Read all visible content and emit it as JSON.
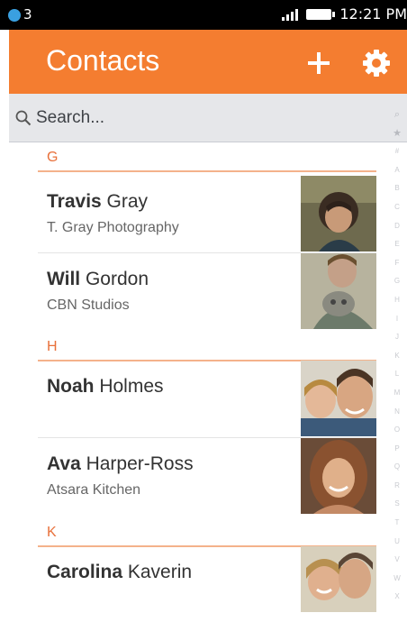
{
  "status_bar": {
    "notification_count": "3",
    "time": "12:21 PM"
  },
  "header": {
    "title": "Contacts"
  },
  "search": {
    "placeholder": "Search..."
  },
  "sections": [
    {
      "letter": "G"
    },
    {
      "letter": "H"
    },
    {
      "letter": "K"
    }
  ],
  "contacts": [
    {
      "first": "Travis",
      "last": " Gray",
      "org": "T. Gray Photography"
    },
    {
      "first": "Will",
      "last": " Gordon",
      "org": "CBN Studios"
    },
    {
      "first": "Noah",
      "last": " Holmes",
      "org": ""
    },
    {
      "first": "Ava",
      "last": " Harper-Ross",
      "org": "Atsara Kitchen"
    },
    {
      "first": "Carolina",
      "last": " Kaverin",
      "org": ""
    }
  ],
  "alpha_index": {
    "items": [
      "#",
      "A",
      "B",
      "C",
      "D",
      "E",
      "F",
      "G",
      "H",
      "I",
      "J",
      "K",
      "L",
      "M",
      "N",
      "O",
      "P",
      "Q",
      "R",
      "S",
      "T",
      "U",
      "V",
      "W",
      "X",
      "Y",
      "Z"
    ]
  },
  "colors": {
    "header": "#f47d30",
    "section_letter": "#e8703a",
    "search_bar": "#e6e7ea"
  }
}
